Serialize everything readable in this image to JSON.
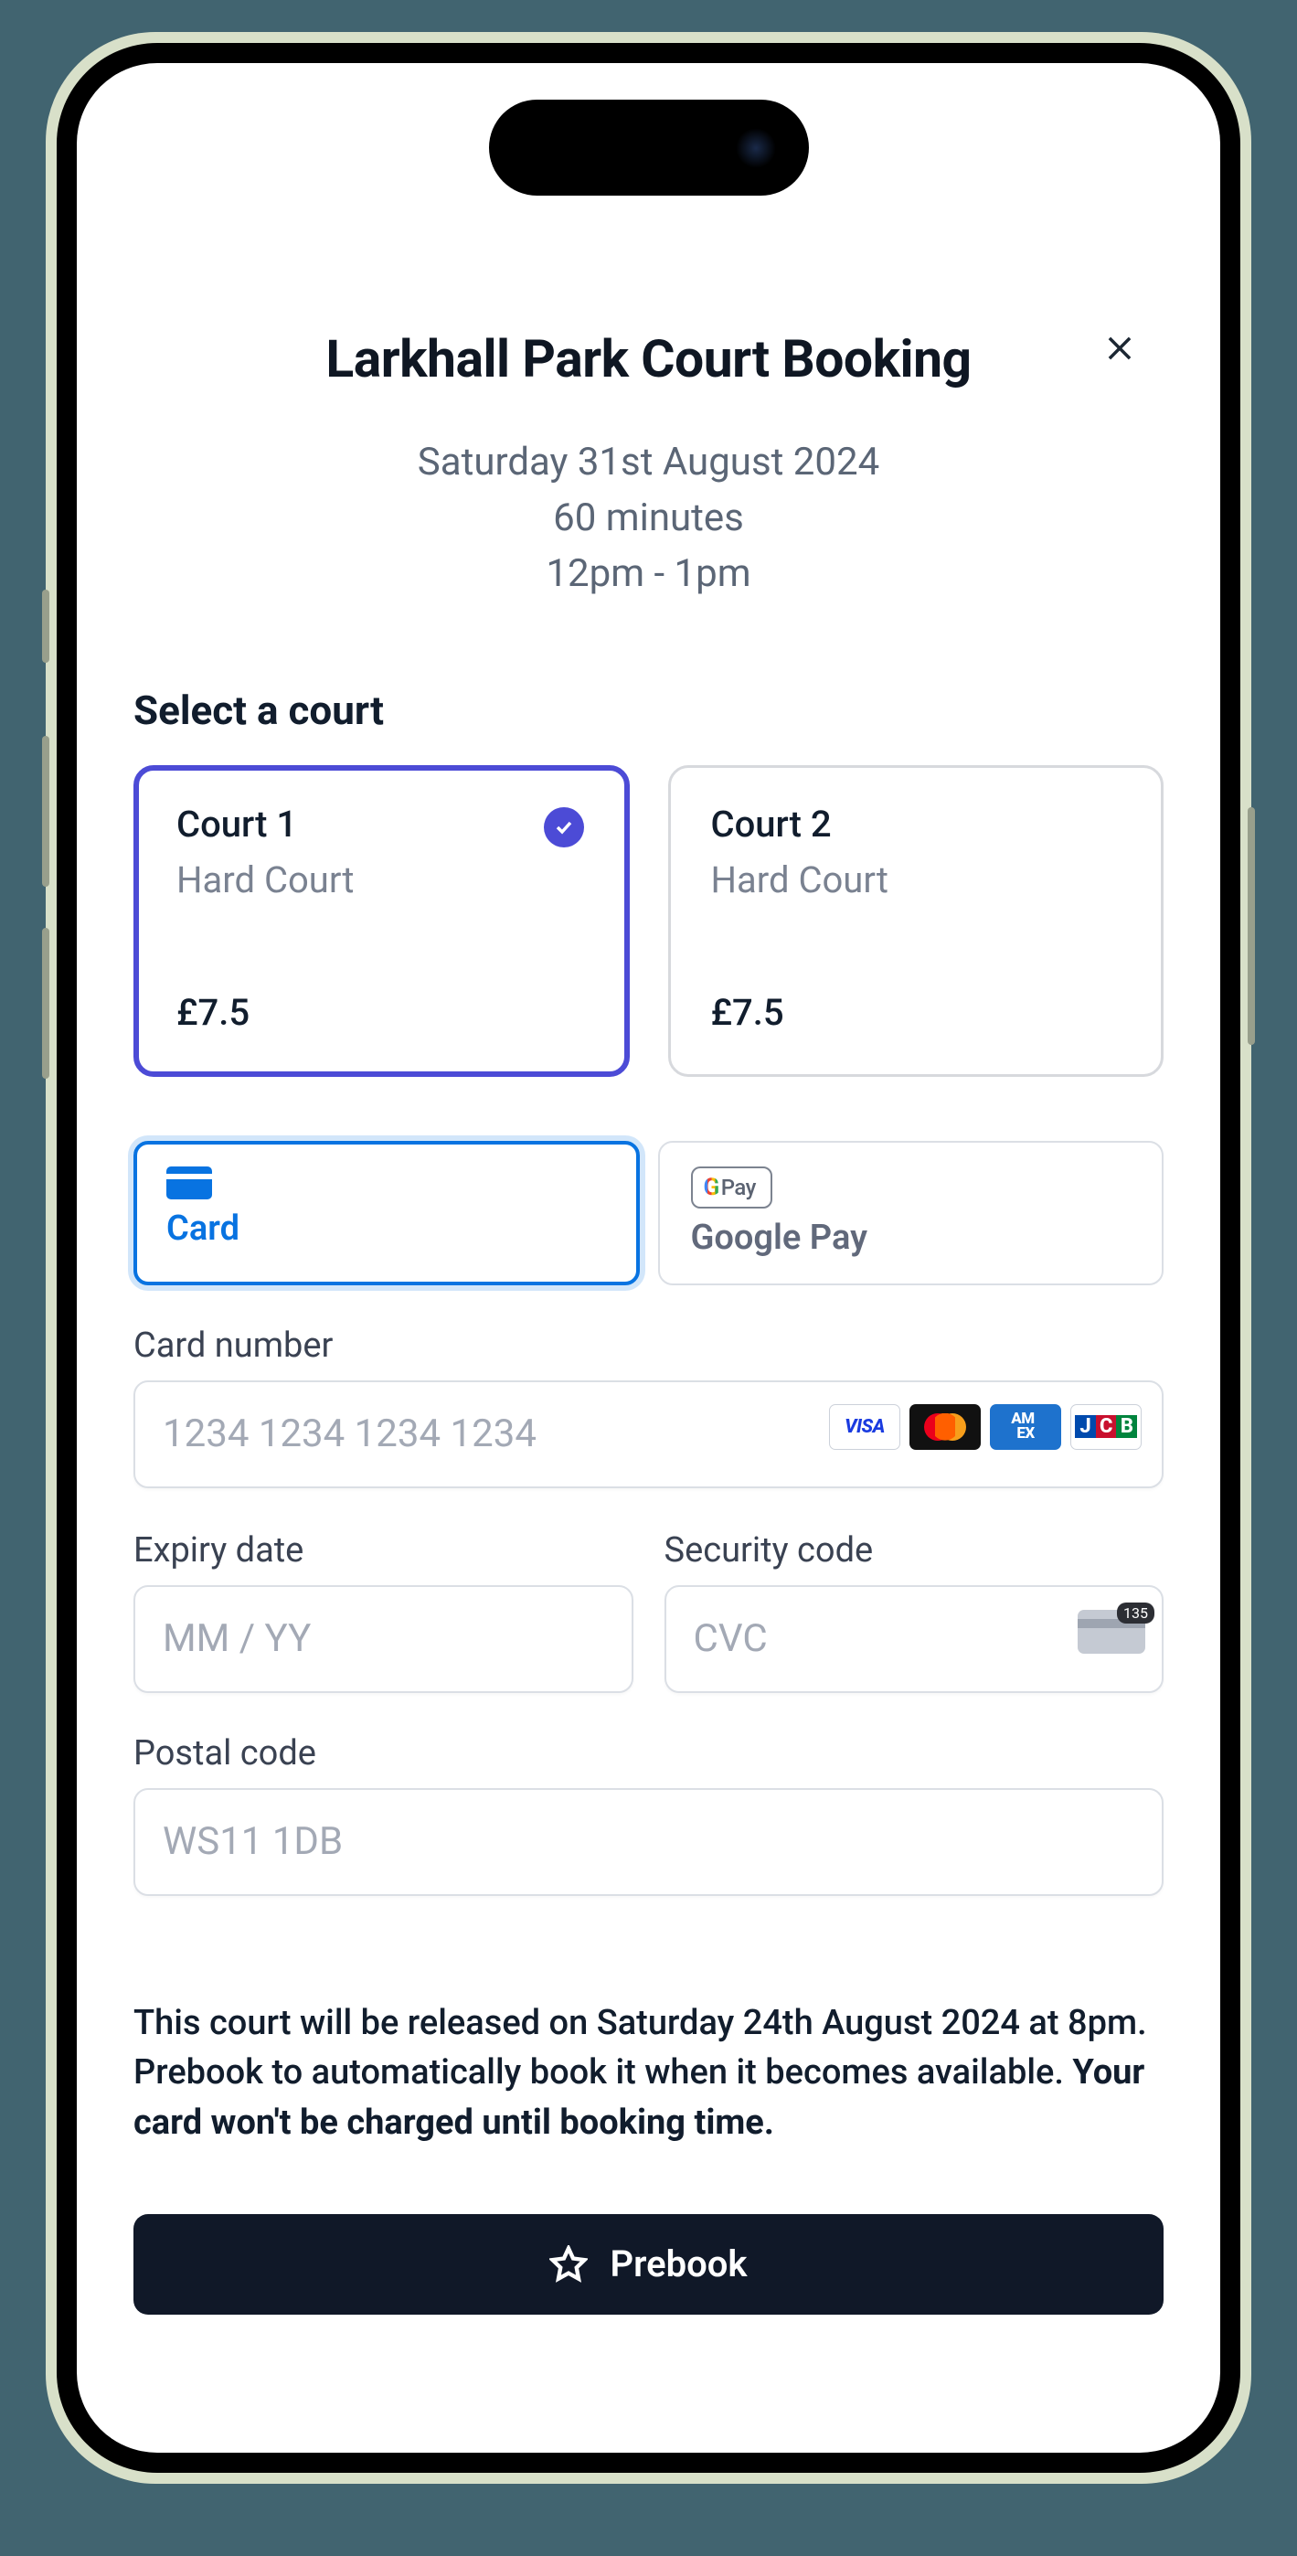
{
  "header": {
    "title": "Larkhall Park Court Booking",
    "date": "Saturday 31st August 2024",
    "duration": "60 minutes",
    "time_range": "12pm - 1pm"
  },
  "court_section": {
    "heading": "Select a court",
    "options": [
      {
        "name": "Court 1",
        "type": "Hard Court",
        "price": "£7.5",
        "selected": true
      },
      {
        "name": "Court 2",
        "type": "Hard Court",
        "price": "£7.5",
        "selected": false
      }
    ]
  },
  "payment_tabs": {
    "card_label": "Card",
    "gpay_label": "Google Pay",
    "gpay_badge": "Pay"
  },
  "form": {
    "card_number_label": "Card number",
    "card_number_placeholder": "1234 1234 1234 1234",
    "expiry_label": "Expiry date",
    "expiry_placeholder": "MM / YY",
    "cvc_label": "Security code",
    "cvc_placeholder": "CVC",
    "cvc_hint": "135",
    "postal_label": "Postal code",
    "postal_placeholder": "WS11 1DB",
    "brands": {
      "visa": "VISA",
      "amex1": "AM",
      "amex2": "EX",
      "j": "J",
      "c": "C",
      "b": "B"
    }
  },
  "notice": {
    "part1": "This court will be released on Saturday 24th August 2024 at 8pm. Prebook to automatically book it when it becomes available. ",
    "part2": "Your card won't be charged until booking time."
  },
  "cta": {
    "label": "Prebook"
  }
}
